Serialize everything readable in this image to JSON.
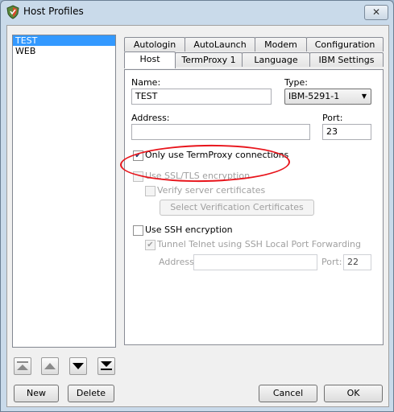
{
  "window": {
    "title": "Host Profiles",
    "close_icon": "close-icon"
  },
  "profiles": [
    "TEST",
    "WEB"
  ],
  "selected_profile": "TEST",
  "tabs_back": [
    "Autologin",
    "AutoLaunch",
    "Modem",
    "Configuration"
  ],
  "tabs_front": [
    "Host",
    "TermProxy 1",
    "Language",
    "IBM Settings"
  ],
  "active_tab": "Host",
  "host": {
    "name_label": "Name:",
    "name_value": "TEST",
    "type_label": "Type:",
    "type_value": "IBM-5291-1",
    "address_label": "Address:",
    "address_value": "",
    "port_label": "Port:",
    "port_value": "23",
    "termproxy_label": "Only use TermProxy connections",
    "termproxy_checked": true,
    "ssl_label": "Use SSL/TLS encryption",
    "ssl_checked": false,
    "verify_label": "Verify server certificates",
    "verify_checked": false,
    "select_cert_label": "Select Verification Certificates",
    "ssh_label": "Use SSH encryption",
    "ssh_checked": false,
    "tunnel_label": "Tunnel Telnet using SSH Local Port Forwarding",
    "tunnel_checked": true,
    "ssh_address_label": "Address:",
    "ssh_address_value": "",
    "ssh_port_label": "Port:",
    "ssh_port_value": "22"
  },
  "buttons": {
    "new": "New",
    "delete": "Delete",
    "cancel": "Cancel",
    "ok": "OK"
  },
  "colors": {
    "selection": "#3399ff",
    "annotation": "#e8141b"
  }
}
